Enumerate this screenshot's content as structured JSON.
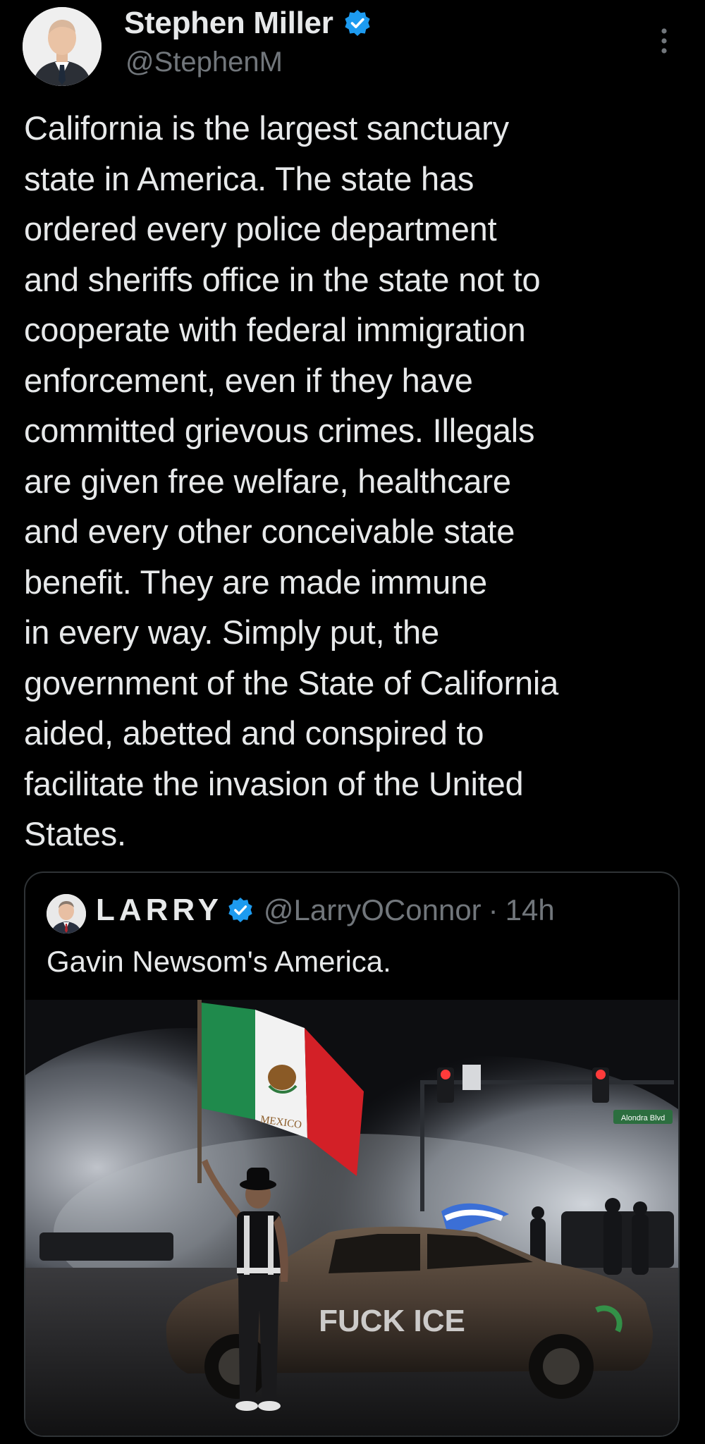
{
  "tweet": {
    "author": {
      "display_name": "Stephen Miller",
      "handle": "@StephenM",
      "verified": true,
      "avatar_icon": "profile-photo"
    },
    "more_icon": "more-vertical-icon",
    "text": "California is the largest sanctuary\nstate in America. The state has\nordered every police department\nand sheriffs office in the state not to\ncooperate with federal immigration\nenforcement, even if they have\ncommitted grievous crimes. Illegals\nare given free welfare, healthcare\nand every other conceivable state\nbenefit. They are made immune\nin every way. Simply put, the\ngovernment of the State of California\naided, abetted and conspired to\nfacilitate the invasion of the United\nStates."
  },
  "quoted_tweet": {
    "author": {
      "display_name": "LARRY",
      "handle": "@LarryOConnor",
      "verified": true
    },
    "separator": "·",
    "time": "14h",
    "text": "Gavin Newsom's America.",
    "media": {
      "flag_text": "MEXICO",
      "street_sign": "Alondra Blvd",
      "graffiti": "FUCK ICE"
    }
  },
  "colors": {
    "background": "#000000",
    "text_primary": "#e7e9ea",
    "text_secondary": "#71767b",
    "verified_blue": "#1d9bf0",
    "border": "#2f3336"
  }
}
